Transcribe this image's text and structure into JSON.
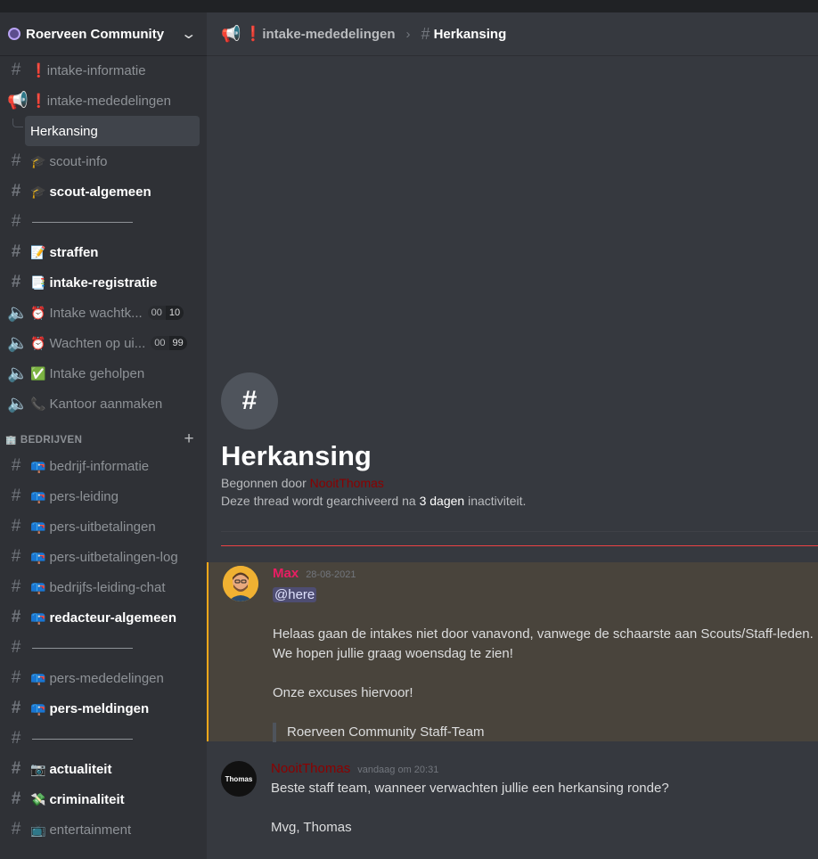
{
  "server": {
    "name": "Roerveen Community"
  },
  "channels_top": [
    {
      "prefix": "❗",
      "name": "intake-informatie",
      "kind": "text",
      "unread": false
    },
    {
      "prefix": "❗",
      "name": "intake-mededelingen",
      "kind": "announce",
      "unread": false
    }
  ],
  "thread_selected": {
    "name": "Herkansing"
  },
  "channels_mid": [
    {
      "emoji": "🎓",
      "name": "scout-info",
      "unread": false
    },
    {
      "emoji": "🎓",
      "name": "scout-algemeen",
      "unread": true
    },
    {
      "emoji": "",
      "name": "",
      "separator": true
    },
    {
      "emoji": "📝",
      "name": "straffen",
      "unread": true
    },
    {
      "emoji": "📑",
      "name": "intake-registratie",
      "unread": true
    }
  ],
  "voice_channels": [
    {
      "emoji": "⏰",
      "name": "Intake wachtk...",
      "count_a": "00",
      "count_b": "10"
    },
    {
      "emoji": "⏰",
      "name": "Wachten op ui...",
      "count_a": "00",
      "count_b": "99"
    },
    {
      "emoji": "✅",
      "name": "Intake geholpen",
      "count_a": "",
      "count_b": ""
    },
    {
      "emoji": "📞",
      "name": "Kantoor aanmaken",
      "count_a": "",
      "count_b": ""
    }
  ],
  "category": {
    "name": "BEDRIJVEN",
    "plus": "+"
  },
  "channels_bottom": [
    {
      "emoji": "📪",
      "name": "bedrijf-informatie",
      "unread": false
    },
    {
      "emoji": "📪",
      "name": "pers-leiding",
      "unread": false
    },
    {
      "emoji": "📪",
      "name": "pers-uitbetalingen",
      "unread": false
    },
    {
      "emoji": "📪",
      "name": "pers-uitbetalingen-log",
      "unread": false
    },
    {
      "emoji": "📪",
      "name": "bedrijfs-leiding-chat",
      "unread": false
    },
    {
      "emoji": "📪",
      "name": "redacteur-algemeen",
      "unread": true
    },
    {
      "emoji": "",
      "name": "",
      "separator": true
    },
    {
      "emoji": "📪",
      "name": "pers-mededelingen",
      "unread": false
    },
    {
      "emoji": "📪",
      "name": "pers-meldingen",
      "unread": true
    },
    {
      "emoji": "",
      "name": "",
      "separator": true
    },
    {
      "emoji": "📷",
      "name": "actualiteit",
      "unread": true
    },
    {
      "emoji": "💸",
      "name": "criminaliteit",
      "unread": true
    },
    {
      "emoji": "📺",
      "name": "entertainment",
      "unread": false
    }
  ],
  "topbar": {
    "parent_prefix": "❗",
    "parent": "intake-mededelingen",
    "title": "Herkansing"
  },
  "thread_intro": {
    "title": "Herkansing",
    "started_by_label": "Begonnen door ",
    "starter": "NooitThomas",
    "archive_prefix": "Deze thread wordt gearchiveerd na ",
    "archive_days": "3 dagen",
    "archive_suffix": " inactiviteit."
  },
  "messages": [
    {
      "author": "Max",
      "timestamp": "28-08-2021",
      "mention": "@here",
      "line1": "Helaas gaan de intakes niet door vanavond, vanwege de schaarste aan Scouts/Staff-leden.",
      "line2": "We hopen jullie graag woensdag te zien!",
      "line3": "Onze excuses hiervoor!",
      "quote": "Roerveen Community Staff-Team"
    },
    {
      "author": "NooitThomas",
      "timestamp": "vandaag om 20:31",
      "avatar_text": "Thomas",
      "line1": "Beste staff team, wanneer verwachten jullie een herkansing ronde?",
      "line2": "Mvg, Thomas"
    }
  ],
  "colors": {
    "mention_bg": "#49443c",
    "mention_bar": "#faa81a",
    "new_divider": "#ed4245",
    "max_name": "#e91e63",
    "thomas_name": "#8b0000"
  }
}
